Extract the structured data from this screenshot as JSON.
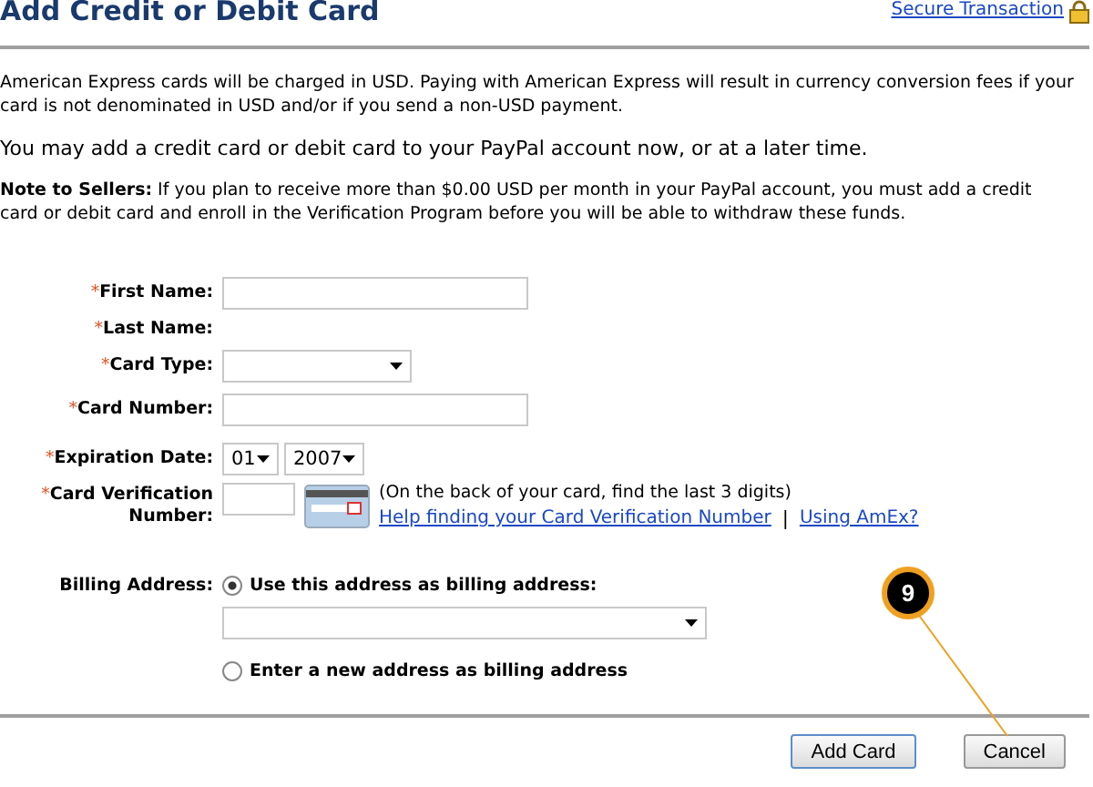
{
  "title": "Add Credit or Debit Card",
  "secure_link": "Secure Transaction",
  "amex_notice": "American Express cards will be charged in USD. Paying with American Express will result in currency conversion fees if your card is not denominated in USD and/or if you send a non-USD payment.",
  "intro": "You may add a credit card or debit card to your PayPal account now, or at a later time.",
  "seller_note": "**Note to Sellers:** If you plan to receive more than $0.00 USD per month in your PayPal account, you must add a credit card or debit card and enroll in the Verification Program before you will be able to withdraw these funds.",
  "fields": [
    {
      "kind": "text",
      "label": "First Name:",
      "required_mark": "*"
    },
    {
      "kind": "blank",
      "label": "Last Name:",
      "required_mark": "*"
    },
    {
      "kind": "select",
      "label": "Card Type:",
      "required_mark": "*"
    },
    {
      "kind": "wide",
      "label": "Card Number:",
      "required_mark": "*"
    },
    {
      "kind": "expiry",
      "label": "Expiration Date:",
      "required_mark": "*",
      "month": "01",
      "year": "2007"
    },
    {
      "kind": "cvv",
      "label": "Card Verification Number:",
      "required_mark": "*",
      "hint": "(On the back of your card, find the last 3 digits)",
      "links": [
        "Help finding your Card Verification Number",
        "Using AmEx?"
      ],
      "separator": "|"
    }
  ],
  "billing": {
    "label": "Billing Address:",
    "options": [
      {
        "kind": "existing",
        "label": "Use this address as billing address:",
        "selected": true
      },
      {
        "kind": "new",
        "label": "Enter a new address as billing address",
        "selected": false
      }
    ]
  },
  "buttons": [
    {
      "label": "Add Card",
      "primary": true
    },
    {
      "label": "Cancel",
      "primary": false
    }
  ],
  "callout": "9"
}
